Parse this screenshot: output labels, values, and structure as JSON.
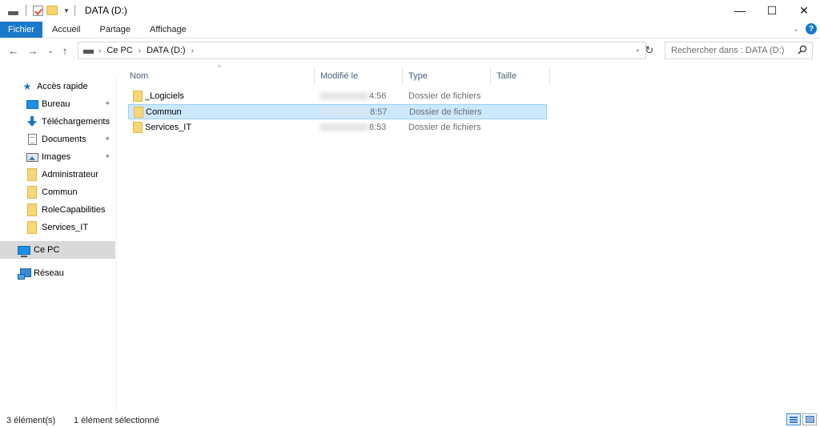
{
  "window": {
    "title": "DATA (D:)",
    "controls": {
      "minimize": "—",
      "maximize": "☐",
      "close": "✕"
    }
  },
  "ribbon": {
    "tabs": [
      "Fichier",
      "Accueil",
      "Partage",
      "Affichage"
    ],
    "expand_glyph": "⌄",
    "help_glyph": "?"
  },
  "navigation": {
    "back": "←",
    "forward": "→",
    "recent": "⌄",
    "up": "↑",
    "breadcrumbs": [
      "Ce PC",
      "DATA (D:)"
    ],
    "crumb_sep": "›",
    "address_dropdown": "⌄",
    "refresh": "↻",
    "search_placeholder": "Rechercher dans : DATA (D:)"
  },
  "sidebar": {
    "quick_access": "Accès rapide",
    "pin_glyph": "📌",
    "items": [
      {
        "label": "Bureau",
        "icon": "desktop-icon",
        "pinned": true
      },
      {
        "label": "Téléchargements",
        "icon": "download-icon",
        "pinned": true
      },
      {
        "label": "Documents",
        "icon": "documents-icon",
        "pinned": true
      },
      {
        "label": "Images",
        "icon": "images-icon",
        "pinned": true
      },
      {
        "label": "Administrateur",
        "icon": "folder-icon",
        "pinned": false
      },
      {
        "label": "Commun",
        "icon": "folder-icon",
        "pinned": false
      },
      {
        "label": "RoleCapabilities",
        "icon": "folder-icon",
        "pinned": false
      },
      {
        "label": "Services_IT",
        "icon": "folder-icon",
        "pinned": false
      }
    ],
    "this_pc": "Ce PC",
    "network": "Réseau"
  },
  "columns": {
    "name": "Nom",
    "modified": "Modifié le",
    "type": "Type",
    "size": "Taille",
    "sort_glyph": "^"
  },
  "files": [
    {
      "name": "_Logiciels",
      "modified": "4:56",
      "type": "Dossier de fichiers",
      "selected": false
    },
    {
      "name": "Commun",
      "modified": "8:57",
      "type": "Dossier de fichiers",
      "selected": true
    },
    {
      "name": "Services_IT",
      "modified": "8:53",
      "type": "Dossier de fichiers",
      "selected": false
    }
  ],
  "status": {
    "count": "3 élément(s)",
    "selection": "1 élément sélectionné"
  },
  "colors": {
    "accent": "#1979ca",
    "selection_bg": "#cce8ff",
    "selection_border": "#99d1ff",
    "folder": "#f8d775"
  }
}
